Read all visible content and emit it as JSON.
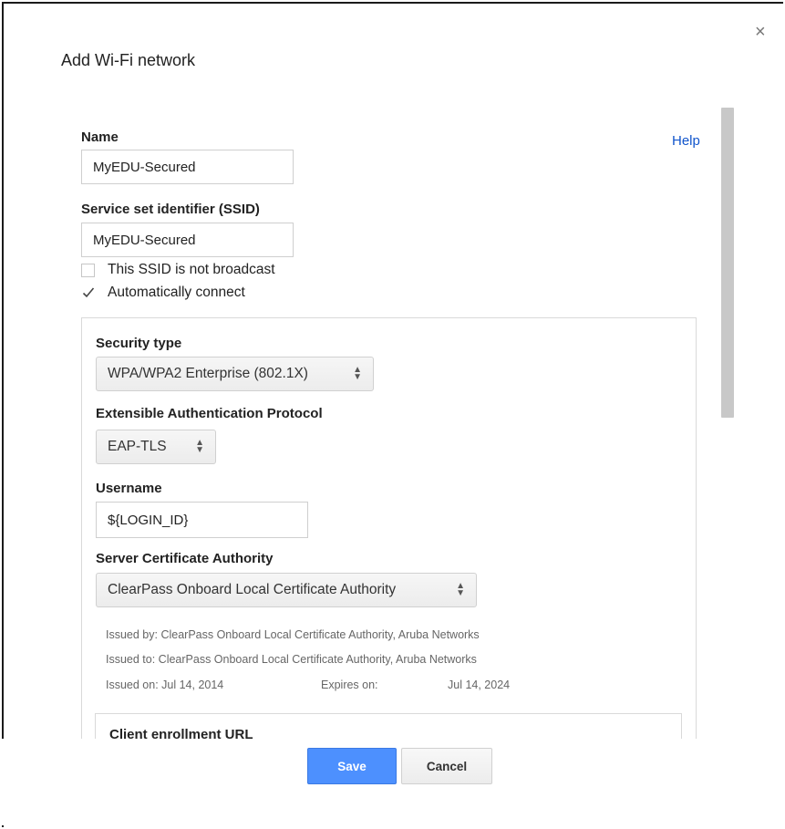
{
  "dialog": {
    "title": "Add Wi-Fi network",
    "close_glyph": "×",
    "help_link": "Help"
  },
  "name": {
    "label": "Name",
    "value": "MyEDU-Secured"
  },
  "ssid": {
    "label": "Service set identifier (SSID)",
    "value": "MyEDU-Secured",
    "not_broadcast_label": "This SSID is not broadcast",
    "not_broadcast_checked": false,
    "auto_connect_label": "Automatically connect",
    "auto_connect_checked": true
  },
  "security": {
    "type_label": "Security type",
    "type_value": "WPA/WPA2 Enterprise (802.1X)",
    "eap_label": "Extensible Authentication Protocol",
    "eap_value": "EAP-TLS",
    "username_label": "Username",
    "username_value": "${LOGIN_ID}",
    "ca_label": "Server Certificate Authority",
    "ca_value": "ClearPass Onboard Local Certificate Authority"
  },
  "certificate": {
    "issued_by": "Issued by: ClearPass Onboard Local Certificate Authority, Aruba Networks",
    "issued_to": "Issued to:  ClearPass Onboard Local Certificate Authority, Aruba Networks",
    "issued_on": "Issued on: Jul 14, 2014",
    "expires_on_label": "Expires on:",
    "expires_on_value": "Jul 14, 2024"
  },
  "client_enrollment": {
    "label": "Client enrollment URL"
  },
  "buttons": {
    "save": "Save",
    "cancel": "Cancel"
  },
  "colors": {
    "accent": "#4d90fe",
    "link": "#1155cc"
  }
}
